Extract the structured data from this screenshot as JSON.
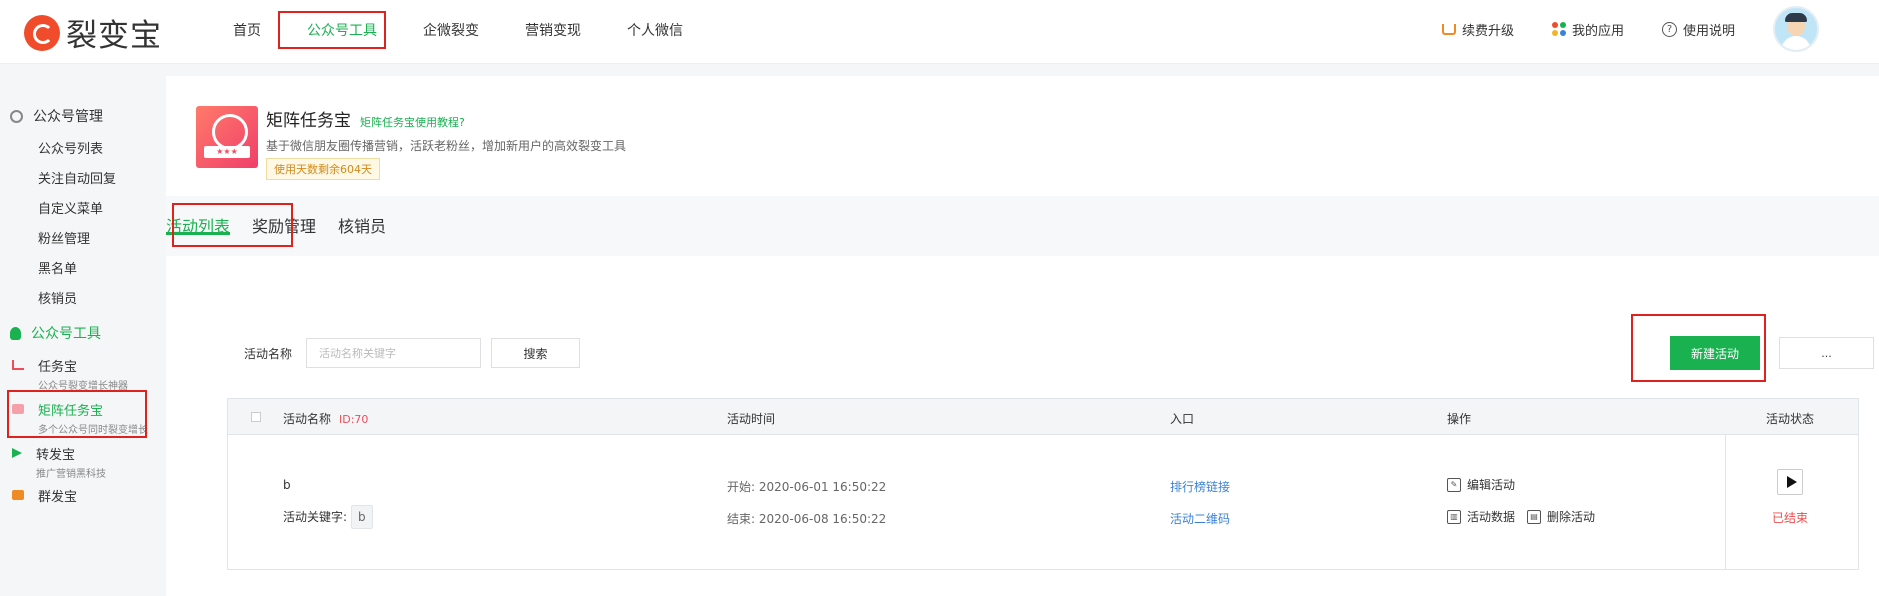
{
  "app": {
    "logo_text": "裂变宝"
  },
  "nav": {
    "items": [
      "首页",
      "公众号工具",
      "企微裂变",
      "营销变现",
      "个人微信"
    ],
    "active_index": 1
  },
  "top_right": {
    "upgrade": "续费升级",
    "my_apps": "我的应用",
    "help": "使用说明"
  },
  "sidebar": {
    "section1": "公众号管理",
    "section1_items": [
      "公众号列表",
      "关注自动回复",
      "自定义菜单",
      "粉丝管理",
      "黑名单",
      "核销员"
    ],
    "section2": "公众号工具",
    "tools": [
      {
        "title": "任务宝",
        "sub": "公众号裂变增长神器"
      },
      {
        "title": "矩阵任务宝",
        "sub": "多个公众号同时裂变增长"
      },
      {
        "title": "转发宝",
        "sub": "推广营销黑科技"
      },
      {
        "title": "群发宝",
        "sub": ""
      }
    ],
    "active_tool_index": 1
  },
  "hero": {
    "title": "矩阵任务宝",
    "tutorial_link": "矩阵任务宝使用教程?",
    "description": "基于微信朋友圈传播营销，活跃老粉丝，增加新用户的高效裂变工具",
    "badge": "使用天数剩余604天"
  },
  "tabs": [
    "活动列表",
    "奖励管理",
    "核销员"
  ],
  "search": {
    "label": "活动名称",
    "placeholder": "活动名称关键字",
    "button": "搜索"
  },
  "actions": {
    "new_activity": "新建活动",
    "more": "..."
  },
  "table": {
    "headers": {
      "name": "活动名称",
      "id_tag": "ID:70",
      "time": "活动时间",
      "entry": "入口",
      "operations": "操作",
      "status": "活动状态"
    },
    "row": {
      "name": "b",
      "keyword_label": "活动关键字:",
      "keyword": "b",
      "start": "开始: 2020-06-01 16:50:22",
      "end": "结束: 2020-06-08 16:50:22",
      "entry_rank": "排行榜链接",
      "entry_qr": "活动二维码",
      "op_edit": "编辑活动",
      "op_data": "活动数据",
      "op_delete": "删除活动",
      "status": "已结束"
    }
  },
  "colors": {
    "accent_green": "#1ab150",
    "highlight_red": "#e0221f",
    "link_blue": "#3b82d6",
    "status_red": "#f04b4b"
  }
}
